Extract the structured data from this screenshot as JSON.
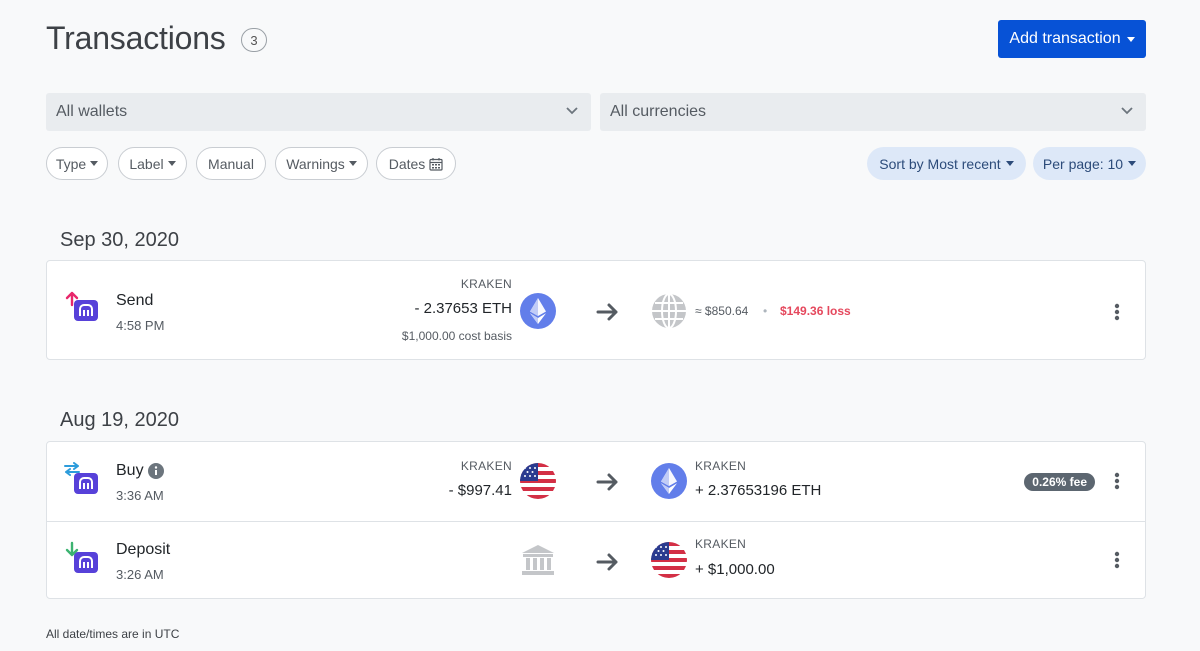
{
  "header": {
    "title": "Transactions",
    "count": "3",
    "add_button": "Add transaction"
  },
  "filters": {
    "wallets": "All wallets",
    "currencies": "All currencies",
    "pills": [
      "Type",
      "Label",
      "Manual",
      "Warnings",
      "Dates"
    ],
    "sort": "Sort by Most recent",
    "per_page": "Per page: 10"
  },
  "groups": [
    {
      "date": "Sep 30, 2020",
      "transactions": [
        {
          "type": "Send",
          "time": "4:58 PM",
          "source_wallet": "KRAKEN",
          "source_amount": "- 2.37653 ETH",
          "cost_basis": "$1,000.00 cost basis",
          "value": "≈ $850.64",
          "separator": "•",
          "gain_loss": "$149.36 loss"
        }
      ]
    },
    {
      "date": "Aug 19, 2020",
      "transactions": [
        {
          "type": "Buy",
          "time": "3:36 AM",
          "source_wallet": "KRAKEN",
          "source_amount": "- $997.41",
          "dest_wallet": "KRAKEN",
          "dest_amount": "+ 2.37653196 ETH",
          "fee": "0.26% fee"
        },
        {
          "type": "Deposit",
          "time": "3:26 AM",
          "dest_wallet": "KRAKEN",
          "dest_amount": "+ $1,000.00"
        }
      ]
    }
  ],
  "footnote": "All date/times are in UTC",
  "colors": {
    "primary": "#0752d6",
    "loss": "#e5485d",
    "eth": "#627eea",
    "app_purple": "#5741d9",
    "send_arrow": "#e8286b",
    "deposit_arrow": "#3cb371",
    "buy_arrow": "#2d9cdb"
  }
}
